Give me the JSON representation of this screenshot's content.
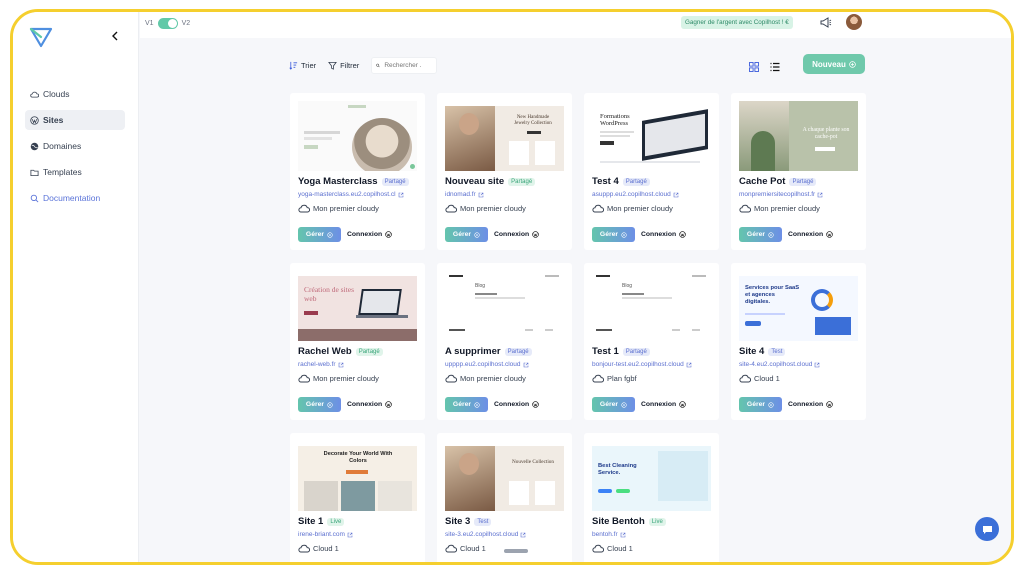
{
  "version": {
    "left": "V1",
    "right": "V2"
  },
  "earn_badge": "Gagner de l'argent avec Copilhost ! €",
  "sidebar": {
    "items": [
      {
        "label": "Clouds",
        "icon": "cloud-icon"
      },
      {
        "label": "Sites",
        "icon": "wordpress-icon",
        "active": true
      },
      {
        "label": "Domaines",
        "icon": "globe-icon"
      },
      {
        "label": "Templates",
        "icon": "folder-icon"
      },
      {
        "label": "Documentation",
        "icon": "search-icon"
      }
    ]
  },
  "toolbar": {
    "sort_label": "Trier",
    "filter_label": "Filtrer",
    "search_placeholder": "Rechercher .",
    "new_label": "Nouveau"
  },
  "actions": {
    "manage": "Gérer",
    "login": "Connexion"
  },
  "sites": [
    {
      "name": "Yoga Masterclass",
      "badge": "Partagé",
      "badge_type": "partage",
      "url": "yoga-masterclass.eu2.copilhost.cl",
      "cloud": "Mon premier cloudy",
      "thumb_title": ""
    },
    {
      "name": "Nouveau site",
      "badge": "Partagé",
      "badge_type": "partage",
      "url": "idnomad.fr",
      "cloud": "Mon premier cloudy",
      "thumb_title": "New Handmade Jewelry Collection"
    },
    {
      "name": "Test 4",
      "badge": "Partagé",
      "badge_type": "partage",
      "url": "asuppp.eu2.copilhost.cloud",
      "cloud": "Mon premier cloudy",
      "thumb_title": "Formations WordPress"
    },
    {
      "name": "Cache Pot",
      "badge": "Partagé",
      "badge_type": "partage",
      "url": "monpremiersitecopilhost.fr",
      "cloud": "Mon premier cloudy",
      "thumb_title": "A chaque plante son cache-pot"
    },
    {
      "name": "Rachel Web",
      "badge": "Partagé",
      "badge_type": "partage",
      "url": "rachel-web.fr",
      "cloud": "Mon premier cloudy",
      "thumb_title": "Création de sites web"
    },
    {
      "name": "A supprimer",
      "badge": "Partagé",
      "badge_type": "partage",
      "url": "upppp.eu2.copilhost.cloud",
      "cloud": "Mon premier cloudy",
      "thumb_title": "Blog"
    },
    {
      "name": "Test 1",
      "badge": "Partagé",
      "badge_type": "partage",
      "url": "bonjour-test.eu2.copilhost.cloud",
      "cloud": "Plan fgbf",
      "thumb_title": "Blog"
    },
    {
      "name": "Site 4",
      "badge": "Test",
      "badge_type": "test",
      "url": "site-4.eu2.copilhost.cloud",
      "cloud": "Cloud 1",
      "thumb_title": "Services pour SaaS et agences digitales."
    },
    {
      "name": "Site 1",
      "badge": "Live",
      "badge_type": "live",
      "url": "irene-briant.com",
      "cloud": "Cloud 1",
      "thumb_title": "Decorate Your World With Colors"
    },
    {
      "name": "Site 3",
      "badge": "Test",
      "badge_type": "test",
      "url": "site-3.eu2.copilhost.cloud",
      "cloud": "Cloud 1",
      "thumb_title": "Nouvelle Collection"
    },
    {
      "name": "Site Bentoh",
      "badge": "Live",
      "badge_type": "live",
      "url": "bentoh.fr",
      "cloud": "Cloud 1",
      "thumb_title": "Best Cleaning Service."
    }
  ],
  "colors": {
    "accent_green": "#6fc9ab",
    "accent_blue": "#5b6fcf",
    "frame": "#f5cf2e"
  }
}
